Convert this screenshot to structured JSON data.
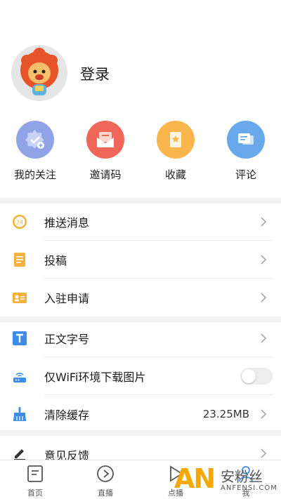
{
  "profile": {
    "login_label": "登录",
    "avatar_icon": "lion-avatar-icon"
  },
  "quick_actions": [
    {
      "label": "我的关注",
      "icon": "follow-badge-icon",
      "color": "#8fa3e6"
    },
    {
      "label": "邀请码",
      "icon": "envelope-icon",
      "color": "#f0675a"
    },
    {
      "label": "收藏",
      "icon": "bookmark-icon",
      "color": "#f8b64c"
    },
    {
      "label": "评论",
      "icon": "comment-icon",
      "color": "#6aa8ec"
    }
  ],
  "menu_group_1": [
    {
      "label": "推送消息",
      "icon": "push-24-icon"
    },
    {
      "label": "投稿",
      "icon": "note-icon"
    },
    {
      "label": "入驻申请",
      "icon": "id-card-icon"
    }
  ],
  "menu_group_2": [
    {
      "label": "正文字号",
      "icon": "text-size-icon"
    },
    {
      "label": "仅WiFi环境下载图片",
      "icon": "router-icon",
      "toggle_on": false
    },
    {
      "label": "清除缓存",
      "icon": "broom-icon",
      "value": "23.25MB"
    }
  ],
  "menu_group_3": [
    {
      "label": "意见反馈",
      "icon": "pencil-icon"
    }
  ],
  "tabbar": [
    {
      "label": "首页",
      "icon": "home-doc-icon"
    },
    {
      "label": "直播",
      "icon": "live-play-icon"
    },
    {
      "label": "点播",
      "icon": "vod-icon"
    },
    {
      "label": "我",
      "icon": "profile-icon"
    }
  ],
  "watermark": {
    "logo": "AN",
    "cn": "安粉丝",
    "en": "ANFENSI.COM"
  }
}
